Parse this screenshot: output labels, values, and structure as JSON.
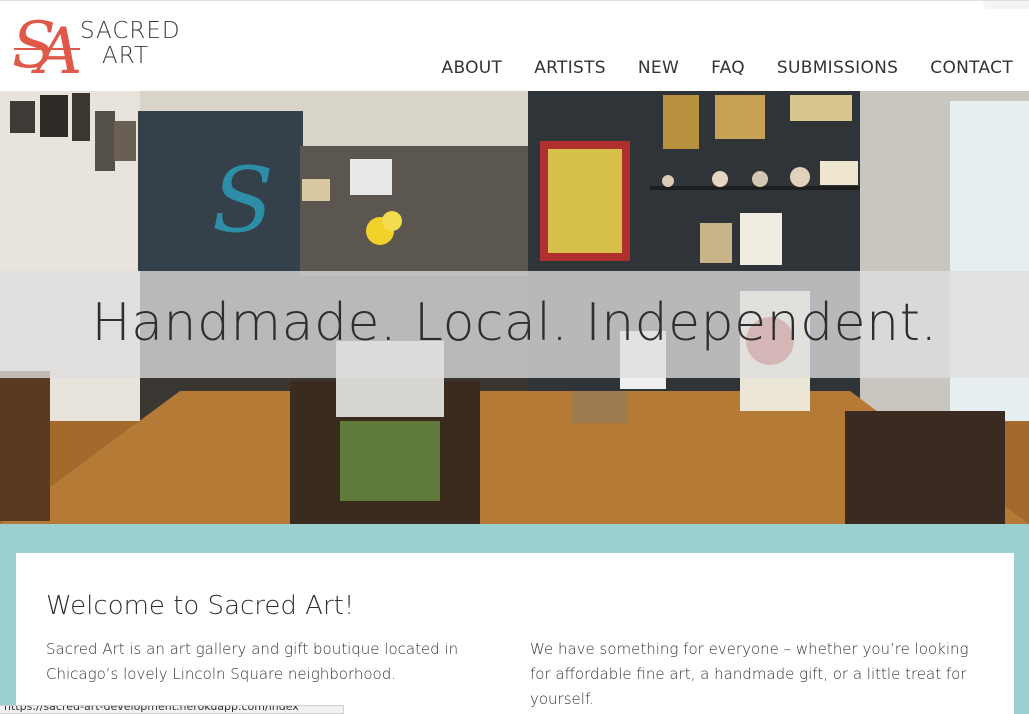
{
  "site": {
    "logo_monogram": "SA",
    "logo_line1": "SACRED",
    "logo_line2": "ART",
    "brand_color": "#e0584a"
  },
  "nav": {
    "items": [
      {
        "label": "ABOUT"
      },
      {
        "label": "ARTISTS"
      },
      {
        "label": "NEW"
      },
      {
        "label": "FAQ"
      },
      {
        "label": "SUBMISSIONS"
      },
      {
        "label": "CONTACT"
      }
    ]
  },
  "hero": {
    "headline": "Handmade. Local. Independent."
  },
  "welcome": {
    "title": "Welcome to Sacred Art!",
    "left_text": "Sacred Art is an art gallery and gift boutique located in Chicago’s lovely Lincoln Square neighborhood.",
    "right_text": "We have something for everyone – whether you’re looking for affordable fine art, a handmade gift, or a little treat for yourself."
  },
  "status_bar": {
    "url": "https://sacred-art-development.herokuapp.com/index"
  },
  "colors": {
    "teal_background": "#9ccfcf",
    "text_dark": "#2e2e2e"
  }
}
